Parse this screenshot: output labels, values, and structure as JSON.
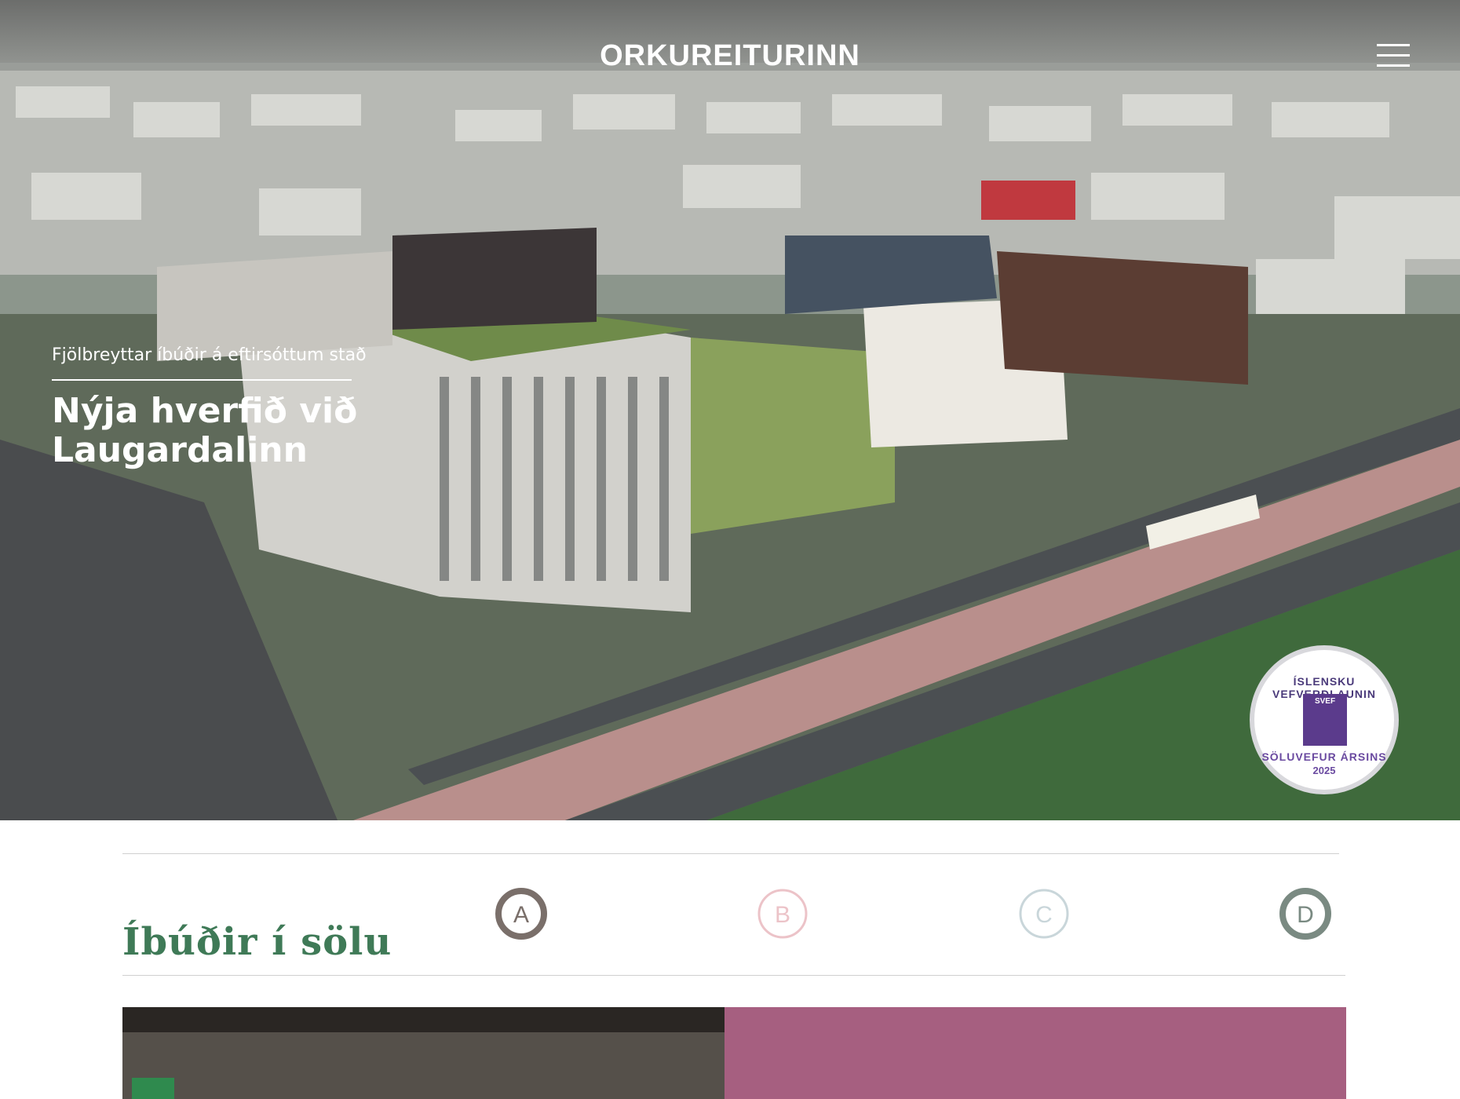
{
  "header": {
    "logo": "ORKUREITURINN",
    "menu_icon": "hamburger-menu-icon"
  },
  "hero": {
    "subtitle": "Fjölbreyttar íbúðir á eftirsóttum stað",
    "title": "Nýja hverfið við Laugardalinn",
    "award": {
      "top_text": "ÍSLENSKU VEFVERÐLAUNIN",
      "box_text": "SVEF",
      "bottom_text": "SÖLUVEFUR ÁRSINS",
      "year": "2025"
    }
  },
  "sales": {
    "title": "Íbúðir í sölu",
    "buildings": [
      {
        "letter": "A",
        "color": "#7a6f6a"
      },
      {
        "letter": "B",
        "color": "#ecc3c8"
      },
      {
        "letter": "C",
        "color": "#c9d6da"
      },
      {
        "letter": "D",
        "color": "#7a8a82"
      }
    ]
  }
}
